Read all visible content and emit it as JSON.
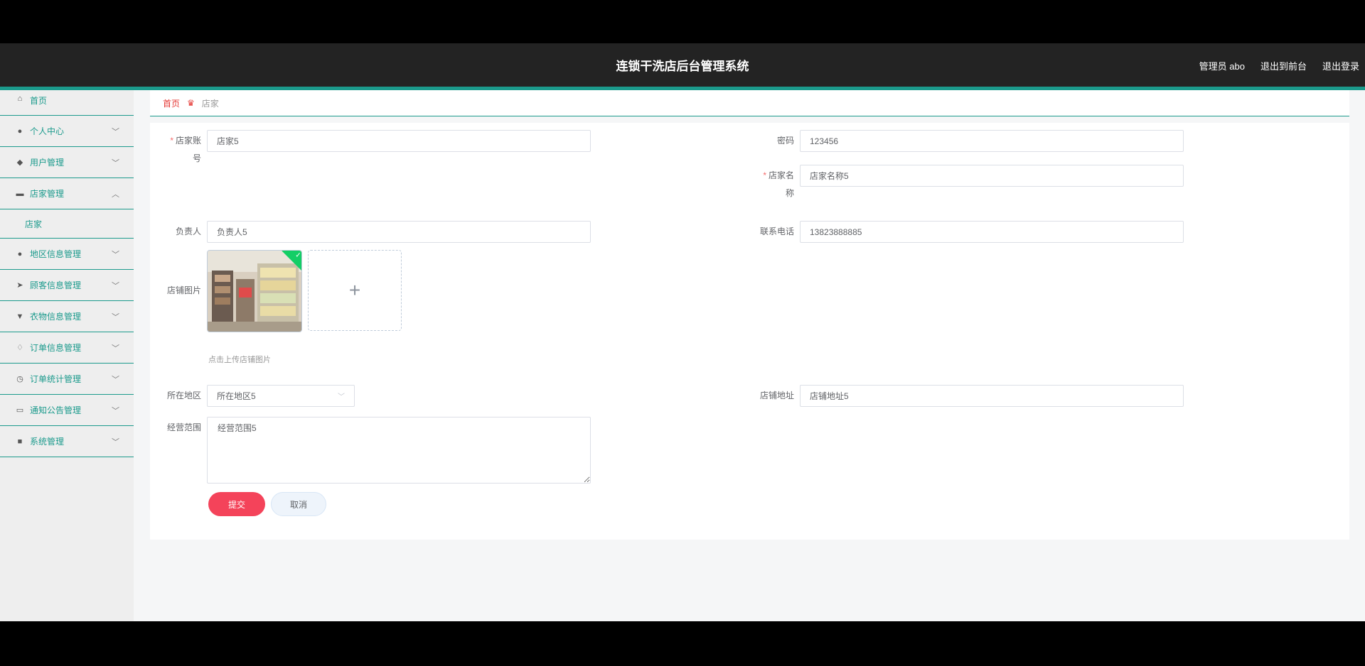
{
  "header": {
    "title": "连锁干洗店后台管理系统",
    "admin": "管理员 abo",
    "exit_front": "退出到前台",
    "logout": "退出登录"
  },
  "sidebar": {
    "items": [
      {
        "label": "首页",
        "icon": "home-icon"
      },
      {
        "label": "个人中心",
        "icon": "user-icon"
      },
      {
        "label": "用户管理",
        "icon": "palette-icon"
      },
      {
        "label": "店家管理",
        "icon": "store-icon"
      },
      {
        "label": "店家",
        "icon": ""
      },
      {
        "label": "地区信息管理",
        "icon": "user-icon"
      },
      {
        "label": "顾客信息管理",
        "icon": "send-icon"
      },
      {
        "label": "衣物信息管理",
        "icon": "box-icon"
      },
      {
        "label": "订单信息管理",
        "icon": "bell-icon"
      },
      {
        "label": "订单统计管理",
        "icon": "clock-icon"
      },
      {
        "label": "通知公告管理",
        "icon": "message-icon"
      },
      {
        "label": "系统管理",
        "icon": "briefcase-icon"
      }
    ]
  },
  "breadcrumb": {
    "home": "首页",
    "current": "店家"
  },
  "form": {
    "account_label_1": "店家账",
    "account_label_2": "号",
    "account_value": "店家5",
    "password_label": "密码",
    "password_value": "123456",
    "name_label_1": "店家名",
    "name_label_2": "称",
    "name_value": "店家名称5",
    "manager_label": "负责人",
    "manager_value": "负责人5",
    "phone_label": "联系电话",
    "phone_value": "13823888885",
    "image_label": "店铺图片",
    "image_hint": "点击上传店铺图片",
    "region_label": "所在地区",
    "region_value": "所在地区5",
    "address_label": "店铺地址",
    "address_value": "店铺地址5",
    "scope_label": "经营范围",
    "scope_value": "经营范围5",
    "submit": "提交",
    "cancel": "取消"
  },
  "colors": {
    "accent": "#1b9a8c",
    "submit": "#f4435a",
    "required": "#f56c6c"
  }
}
